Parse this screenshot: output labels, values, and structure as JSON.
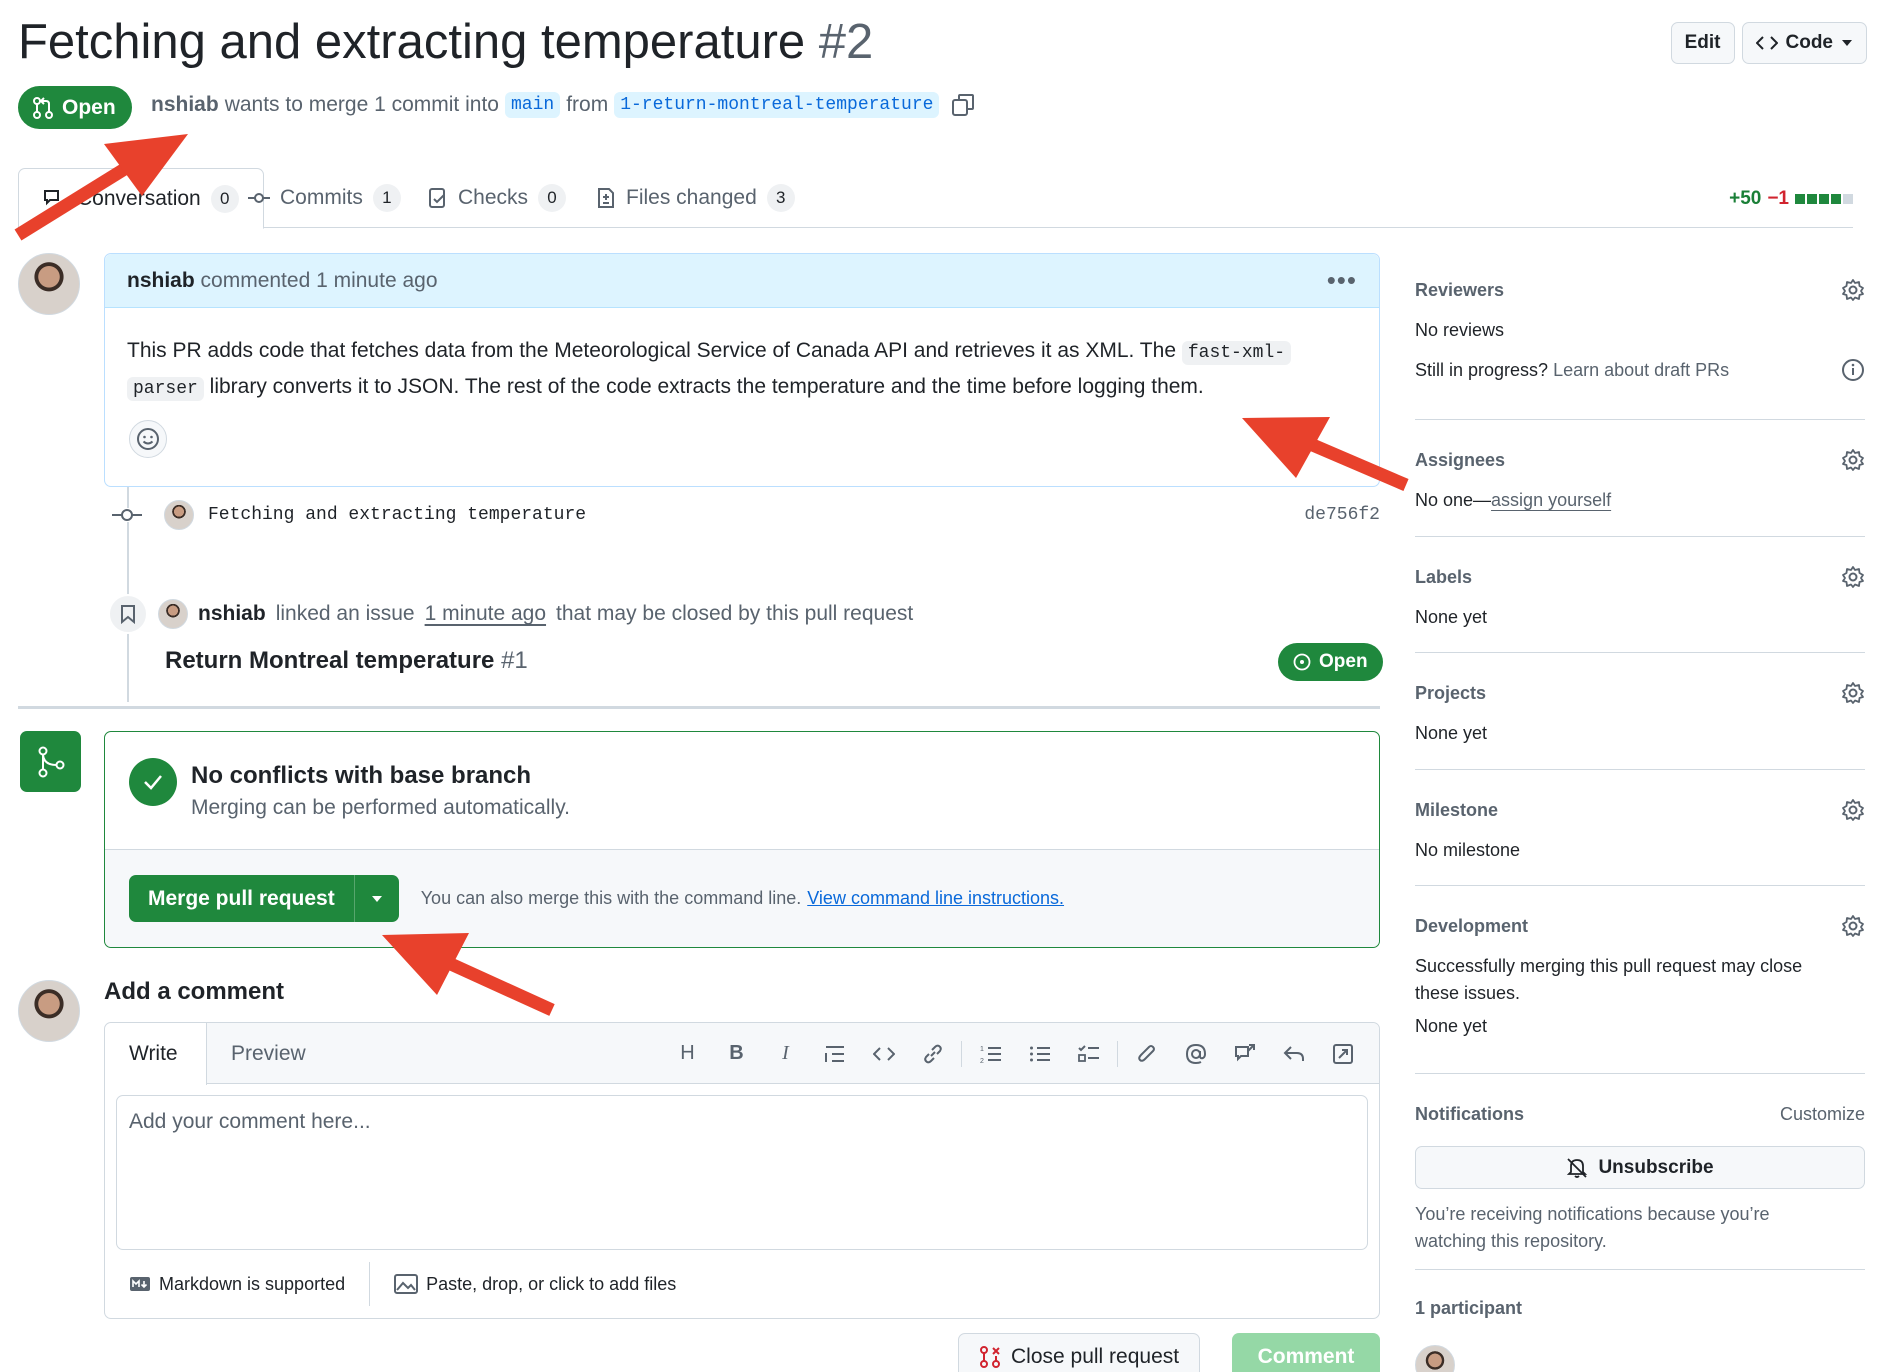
{
  "header": {
    "title": "Fetching and extracting temperature",
    "number": "#2",
    "edit_label": "Edit",
    "code_label": "Code"
  },
  "pr_meta": {
    "state": "Open",
    "author": "nshiab",
    "merge_text": "wants to merge 1 commit into",
    "base_branch": "main",
    "from_text": "from",
    "head_branch": "1-return-montreal-temperature"
  },
  "tabs": [
    {
      "label": "Conversation",
      "count": "0"
    },
    {
      "label": "Commits",
      "count": "1"
    },
    {
      "label": "Checks",
      "count": "0"
    },
    {
      "label": "Files changed",
      "count": "3"
    }
  ],
  "diffstat": {
    "additions": "+50",
    "deletions": "−1"
  },
  "comment": {
    "author": "nshiab",
    "action": "commented 1 minute ago",
    "body_part1": "This PR adds code that fetches data from the Meteorological Service of Canada API and retrieves it as XML. The",
    "code1a": "fast-xml-",
    "code1b": "parser",
    "body_part2": "library converts it to JSON. The rest of the code extracts the temperature and the time before logging them."
  },
  "commit": {
    "message": "Fetching and extracting temperature",
    "sha": "de756f2"
  },
  "linked": {
    "author": "nshiab",
    "text1": "linked an issue",
    "time": "1 minute ago",
    "text2": "that may be closed by this pull request",
    "issue_title": "Return Montreal temperature",
    "issue_number": "#1",
    "issue_state": "Open"
  },
  "merge": {
    "heading": "No conflicts with base branch",
    "sub": "Merging can be performed automatically.",
    "button": "Merge pull request",
    "hint": "You can also merge this with the command line.",
    "link": "View command line instructions."
  },
  "add_comment": {
    "title": "Add a comment",
    "tab_write": "Write",
    "tab_preview": "Preview",
    "placeholder": "Add your comment here...",
    "markdown": "Markdown is supported",
    "attach": "Paste, drop, or click to add files",
    "close_button": "Close pull request",
    "comment_button": "Comment"
  },
  "sidebar": {
    "reviewers": {
      "title": "Reviewers",
      "value": "No reviews",
      "draft_q": "Still in progress?",
      "draft_link": "Learn about draft PRs"
    },
    "assignees": {
      "title": "Assignees",
      "value_prefix": "No one—",
      "value_link": "assign yourself"
    },
    "labels": {
      "title": "Labels",
      "value": "None yet"
    },
    "projects": {
      "title": "Projects",
      "value": "None yet"
    },
    "milestone": {
      "title": "Milestone",
      "value": "No milestone"
    },
    "development": {
      "title": "Development",
      "line1": "Successfully merging this pull request may close",
      "line2": "these issues.",
      "value": "None yet"
    },
    "notifications": {
      "title": "Notifications",
      "customize": "Customize",
      "unsubscribe": "Unsubscribe",
      "line1": "You’re receiving notifications because you’re",
      "line2": "watching this repository."
    },
    "participants": {
      "title": "1 participant"
    }
  },
  "colors": {
    "green": "#1f883d",
    "blue": "#0969da",
    "annotation_red": "#e8412c"
  }
}
